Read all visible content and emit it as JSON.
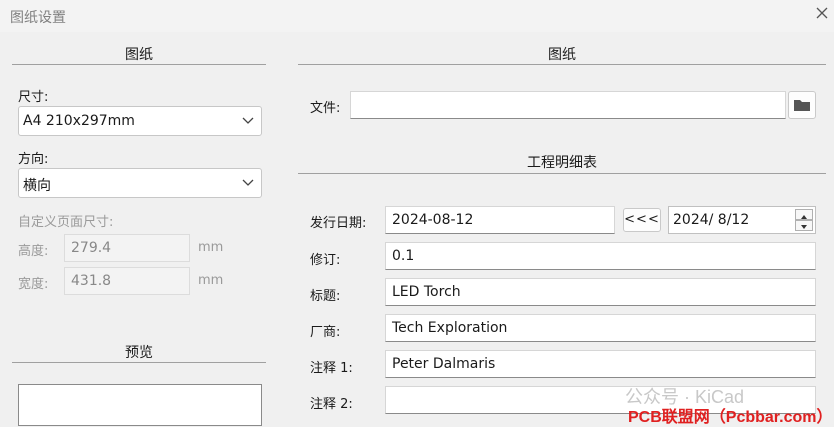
{
  "window": {
    "title": "图纸设置"
  },
  "left": {
    "section_title": "图纸",
    "size_label": "尺寸:",
    "size_value": "A4 210x297mm",
    "orientation_label": "方向:",
    "orientation_value": "横向",
    "custom_label": "自定义页面尺寸:",
    "height_label": "高度:",
    "height_value": "279.4",
    "height_unit": "mm",
    "width_label": "宽度:",
    "width_value": "431.8",
    "width_unit": "mm",
    "preview_title": "预览"
  },
  "right": {
    "section_title": "图纸",
    "file_label": "文件:",
    "file_value": "",
    "details_title": "工程明细表",
    "date_label": "发行日期:",
    "date_value": "2024-08-12",
    "date_copy_button": "<<<",
    "date_picker_value": "2024/  8/12",
    "revision_label": "修订:",
    "revision_value": "0.1",
    "title_label": "标题:",
    "title_value": "LED Torch",
    "company_label": "厂商:",
    "company_value": "Tech Exploration",
    "comment1_label": "注释 1:",
    "comment1_value": "Peter Dalmaris",
    "comment2_label": "注释 2:",
    "comment2_value": ""
  },
  "watermark": {
    "line1": "公众号 · KiCad",
    "line2": "PCB联盟网（Pcbbar.com）"
  },
  "icons": {
    "close": "close-icon",
    "folder": "folder-icon",
    "chevron": "chevron-down-icon"
  }
}
